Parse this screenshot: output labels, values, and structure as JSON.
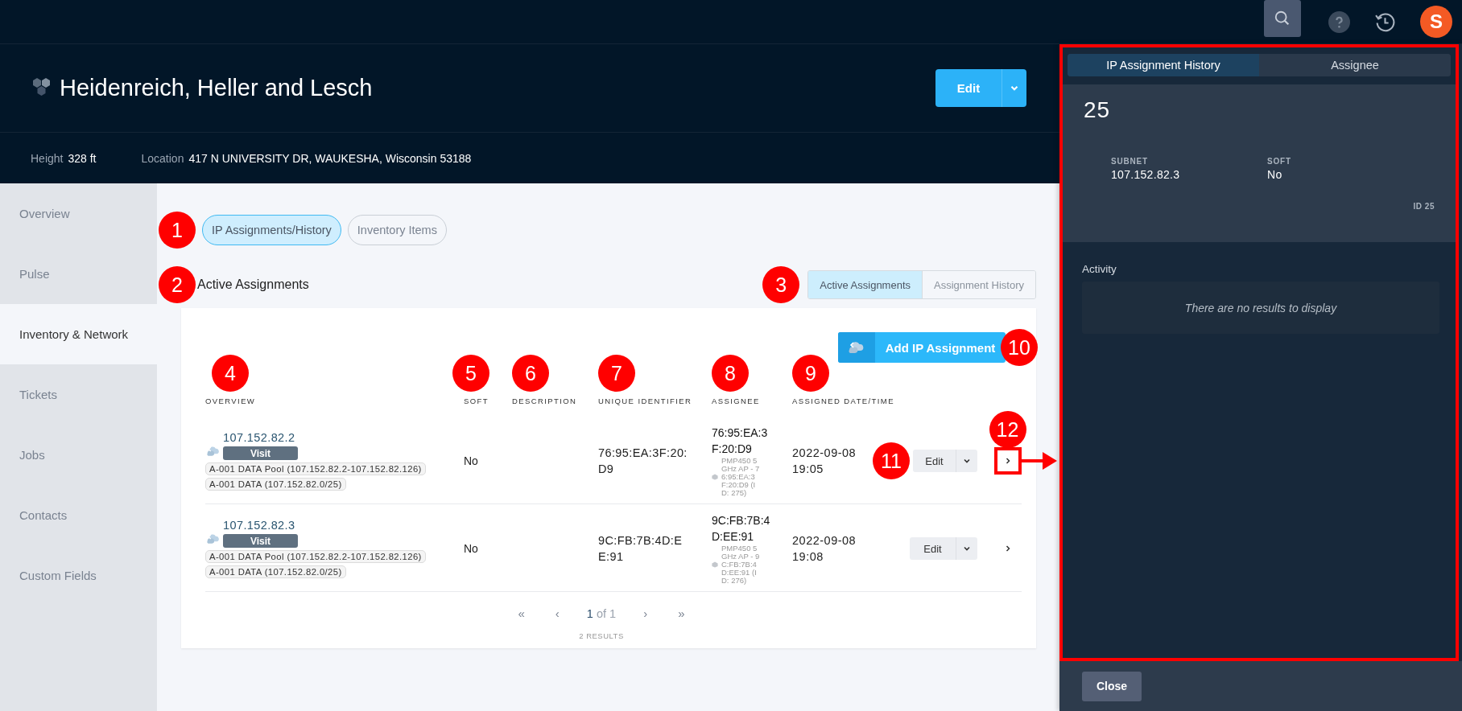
{
  "topbar": {
    "avatar_initial": "S"
  },
  "header": {
    "title": "Heidenreich, Heller and Lesch",
    "edit_button": "Edit"
  },
  "facts": [
    {
      "label": "Height",
      "value": "328 ft"
    },
    {
      "label": "Location",
      "value": "417 N UNIVERSITY DR, WAUKESHA, Wisconsin 53188"
    }
  ],
  "sidebar": {
    "items": [
      {
        "label": "Overview",
        "selected": false
      },
      {
        "label": "Pulse",
        "selected": false
      },
      {
        "label": "Inventory & Network",
        "selected": true
      },
      {
        "label": "Tickets",
        "selected": false
      },
      {
        "label": "Jobs",
        "selected": false
      },
      {
        "label": "Contacts",
        "selected": false
      },
      {
        "label": "Custom Fields",
        "selected": false
      }
    ]
  },
  "pills": [
    {
      "label": "IP Assignments/History",
      "selected": true,
      "marker": "1"
    },
    {
      "label": "Inventory Items",
      "selected": false
    }
  ],
  "section": {
    "title": "Active Assignments",
    "marker": "2"
  },
  "view_toggle": {
    "marker": "3",
    "options": [
      {
        "label": "Active Assignments",
        "selected": true
      },
      {
        "label": "Assignment History",
        "selected": false
      }
    ]
  },
  "add_button": {
    "label": "Add IP Assignment",
    "marker": "10"
  },
  "table": {
    "columns": [
      {
        "label": "OVERVIEW",
        "marker": "4"
      },
      {
        "label": "SOFT",
        "marker": "5"
      },
      {
        "label": "DESCRIPTION",
        "marker": "6"
      },
      {
        "label": "UNIQUE IDENTIFIER",
        "marker": "7"
      },
      {
        "label": "ASSIGNEE",
        "marker": "8"
      },
      {
        "label": "ASSIGNED DATE/TIME",
        "marker": "9"
      }
    ],
    "rows": [
      {
        "ip": "107.152.82.2",
        "visit": "Visit",
        "tags": [
          "A-001 DATA Pool (107.152.82.2-107.152.82.126)",
          "A-001 DATA (107.152.82.0/25)"
        ],
        "soft": "No",
        "unique_identifier": "76:95:EA:3F:20:D9",
        "assignee": "76:95:EA:3F:20:D9",
        "assignee_device": "PMP450 5GHz AP - 76:95:EA:3F:20:D9 (ID: 275)",
        "assigned": "2022-09-08 19:05",
        "edit": "Edit",
        "edit_marker": "11",
        "open_marker": "12",
        "highlighted": true
      },
      {
        "ip": "107.152.82.3",
        "visit": "Visit",
        "tags": [
          "A-001 DATA Pool (107.152.82.2-107.152.82.126)",
          "A-001 DATA (107.152.82.0/25)"
        ],
        "soft": "No",
        "unique_identifier": "9C:FB:7B:4D:EE:91",
        "assignee": "9C:FB:7B:4D:EE:91",
        "assignee_device": "PMP450 5GHz AP - 9C:FB:7B:4D:EE:91 (ID: 276)",
        "assigned": "2022-09-08 19:08",
        "edit": "Edit",
        "highlighted": false
      }
    ]
  },
  "pagination": {
    "first": "«",
    "prev": "‹",
    "page": "1",
    "of": "of 1",
    "next": "›",
    "last": "»",
    "results": "2 RESULTS"
  },
  "detail_panel": {
    "highlighted": true,
    "tabs": [
      {
        "label": "IP Assignment History",
        "selected": true
      },
      {
        "label": "Assignee",
        "selected": false
      }
    ],
    "title": "25",
    "fields": [
      {
        "label": "SUBNET",
        "value": "107.152.82.3"
      },
      {
        "label": "SOFT",
        "value": "No"
      }
    ],
    "id_text": "ID 25",
    "activity_title": "Activity",
    "empty_text": "There are no results to display",
    "close_button": "Close"
  }
}
